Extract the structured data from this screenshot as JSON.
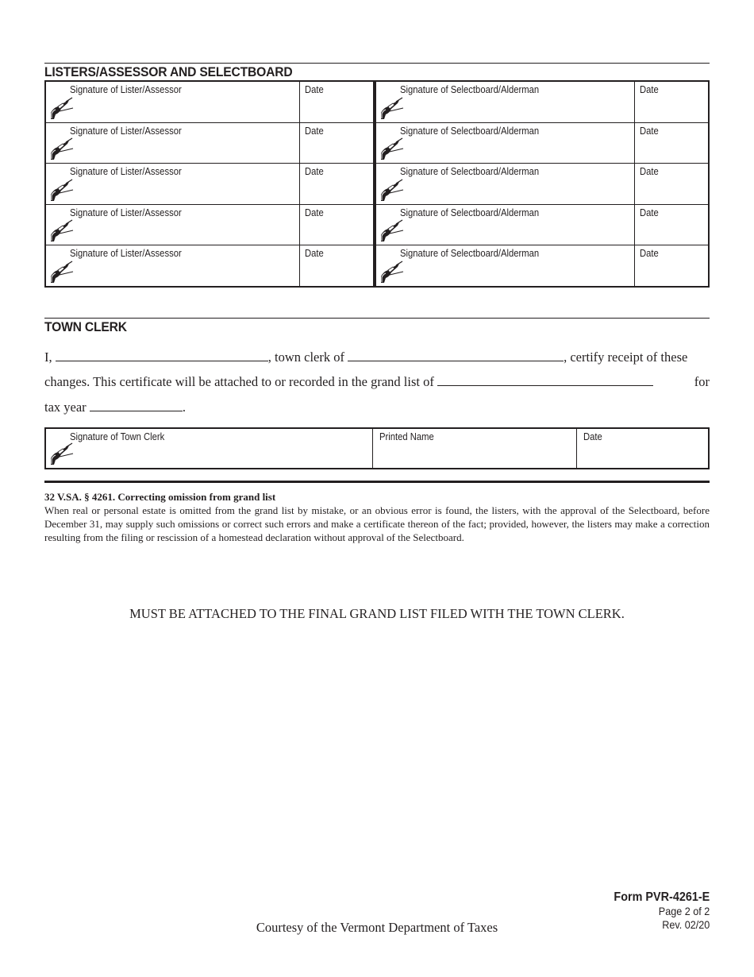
{
  "sections": {
    "listers_title": "LISTERS/ASSESSOR AND SELECTBOARD",
    "clerk_title": "TOWN CLERK"
  },
  "signature_grid": {
    "left_rows": [
      {
        "label": "Signature of Lister/Assessor",
        "date_label": "Date",
        "icon": "pen-hand-icon"
      },
      {
        "label": "Signature of Lister/Assessor",
        "date_label": "Date",
        "icon": "pen-hand-icon"
      },
      {
        "label": "Signature of Lister/Assessor",
        "date_label": "Date",
        "icon": "pen-hand-icon"
      },
      {
        "label": "Signature of Lister/Assessor",
        "date_label": "Date",
        "icon": "pen-hand-icon"
      },
      {
        "label": "Signature of Lister/Assessor",
        "date_label": "Date",
        "icon": "pen-hand-icon"
      }
    ],
    "right_rows": [
      {
        "label": "Signature of Selectboard/Alderman",
        "date_label": "Date",
        "icon": "pen-hand-icon"
      },
      {
        "label": "Signature of Selectboard/Alderman",
        "date_label": "Date",
        "icon": "pen-hand-icon"
      },
      {
        "label": "Signature of Selectboard/Alderman",
        "date_label": "Date",
        "icon": "pen-hand-icon"
      },
      {
        "label": "Signature of Selectboard/Alderman",
        "date_label": "Date",
        "icon": "pen-hand-icon"
      },
      {
        "label": "Signature of Selectboard/Alderman",
        "date_label": "Date",
        "icon": "pen-hand-icon"
      }
    ]
  },
  "clerk_statement": {
    "line1_a": "I,",
    "line1_b": ", town clerk of",
    "line1_c": ", certify receipt of these",
    "line2_a": "changes.  This certificate will be attached to or recorded in the grand list of",
    "line2_b": "for",
    "line3_a": "tax year",
    "line3_b": ".",
    "clerk_name_value": "",
    "town_value": "",
    "grand_list_value": "",
    "tax_year_value": ""
  },
  "clerk_box": {
    "signature_label": "Signature of Town Clerk",
    "printed_name_label": "Printed Name",
    "date_label": "Date"
  },
  "statute": {
    "title": "32 V.SA. § 4261.  Correcting omission from grand list",
    "body": "When real or personal estate is omitted from the grand list by mistake, or an obvious error is found, the listers, with the approval of the Selectboard, before December 31, may supply such omissions or correct such errors and make a certificate thereon of the fact; provided, however, the listers may make a correction resulting from the filing or rescission of a homestead declaration without approval of the Selectboard."
  },
  "attach_note": "MUST BE ATTACHED TO THE FINAL GRAND LIST FILED WITH THE TOWN CLERK.",
  "footer": {
    "courtesy": "Courtesy of the Vermont Department of Taxes",
    "form_number": "Form PVR-4261-E",
    "page": "Page 2 of 2",
    "revision": "Rev. 02/20"
  }
}
